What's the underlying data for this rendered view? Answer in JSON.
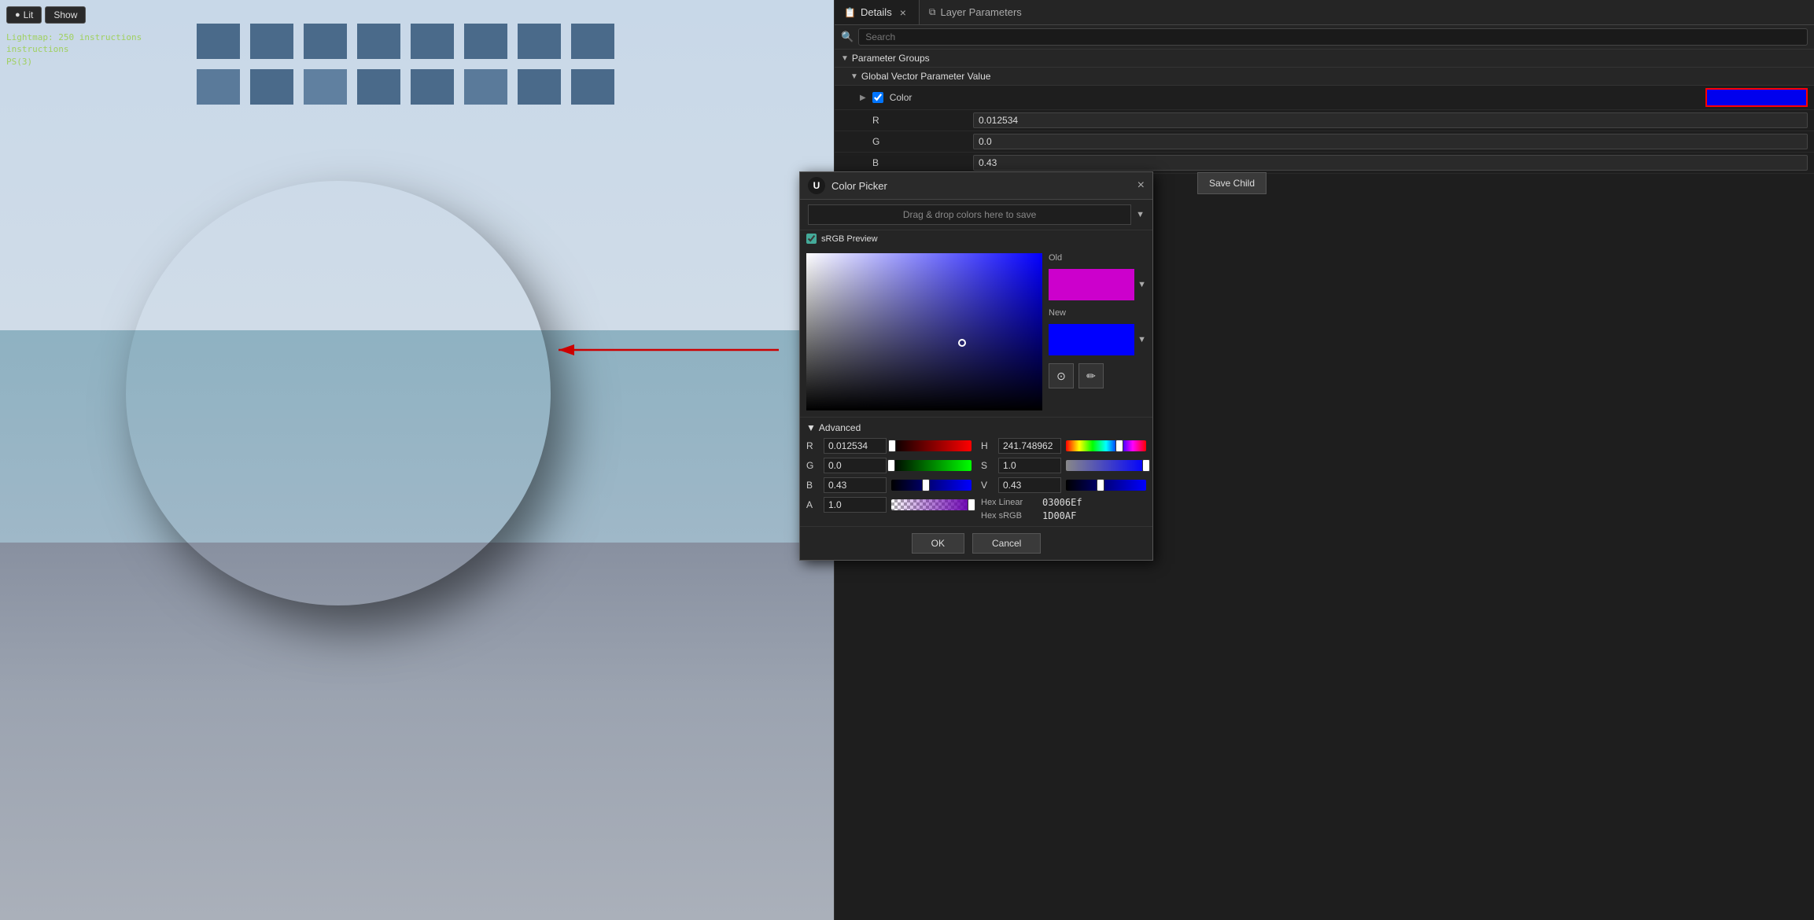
{
  "toolbar": {
    "lit_label": "Lit",
    "show_label": "Show"
  },
  "debug": {
    "line1": "Lightmap: 250 instructions",
    "line2": "instructions",
    "line3": "PS(3)"
  },
  "details_panel": {
    "title": "Details",
    "close_icon": "×",
    "layer_params_title": "Layer Parameters",
    "search_placeholder": "Search"
  },
  "parameter_groups": {
    "label": "Parameter Groups",
    "global_vector": "Global Vector Parameter Value",
    "color_param": "Color",
    "r_label": "R",
    "g_label": "G",
    "b_label": "B",
    "r_value": "0.012534",
    "g_value": "0.0",
    "b_value": "0.43"
  },
  "color_picker": {
    "title": "Color Picker",
    "ue_logo": "U",
    "close_icon": "×",
    "save_child_label": "Save Child",
    "drag_drop_label": "Drag & drop colors here to save",
    "srgb_label": "sRGB Preview",
    "old_label": "Old",
    "new_label": "New",
    "advanced_label": "Advanced",
    "r_label": "R",
    "g_label": "G",
    "b_label": "B",
    "a_label": "A",
    "h_label": "H",
    "s_label": "S",
    "v_label": "V",
    "r_value": "0.012534",
    "g_value": "0.0",
    "b_value": "0.43",
    "a_value": "1.0",
    "h_value": "241.748962",
    "s_value": "1.0",
    "v_value": "0.43",
    "hex_linear_label": "Hex Linear",
    "hex_linear_value": "03006Ef",
    "hex_srgb_label": "Hex sRGB",
    "hex_srgb_value": "1D00AF",
    "ok_label": "OK",
    "cancel_label": "Cancel",
    "color_tool_wheel": "⊙",
    "color_tool_picker": "✏"
  }
}
